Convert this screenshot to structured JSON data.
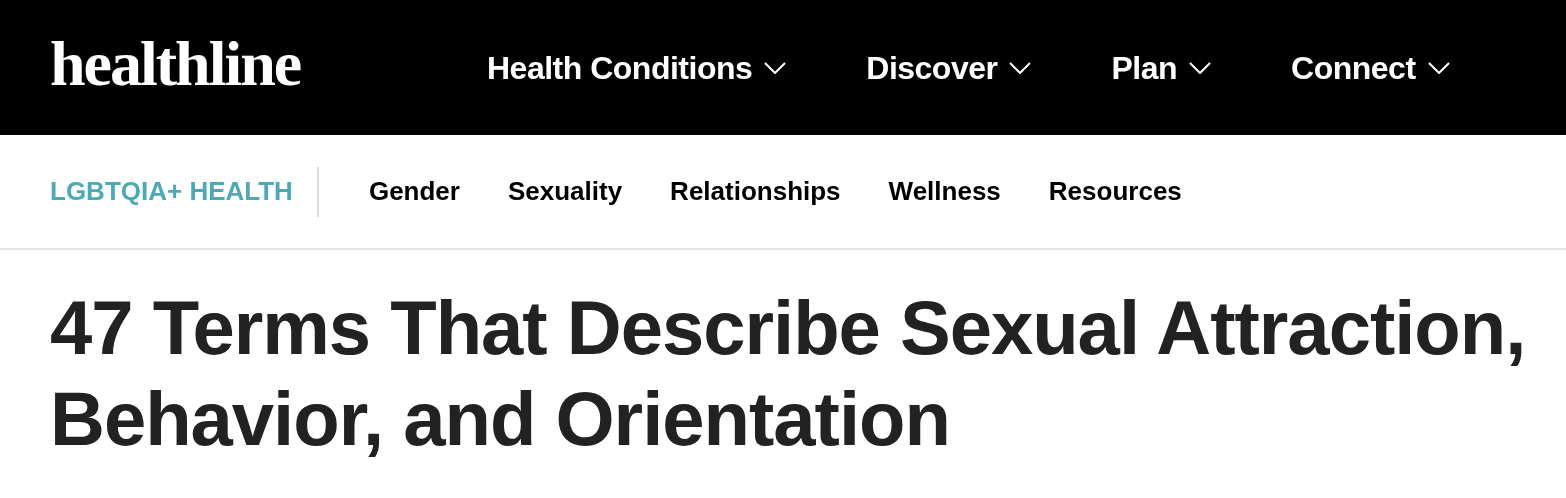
{
  "header": {
    "logo": "healthline",
    "nav": [
      {
        "label": "Health Conditions"
      },
      {
        "label": "Discover"
      },
      {
        "label": "Plan"
      },
      {
        "label": "Connect"
      }
    ]
  },
  "subnav": {
    "section": "LGBTQIA+ HEALTH",
    "items": [
      "Gender",
      "Sexuality",
      "Relationships",
      "Wellness",
      "Resources"
    ]
  },
  "article": {
    "title": "47 Terms That Describe Sexual Attraction, Behavior, and Orientation"
  }
}
